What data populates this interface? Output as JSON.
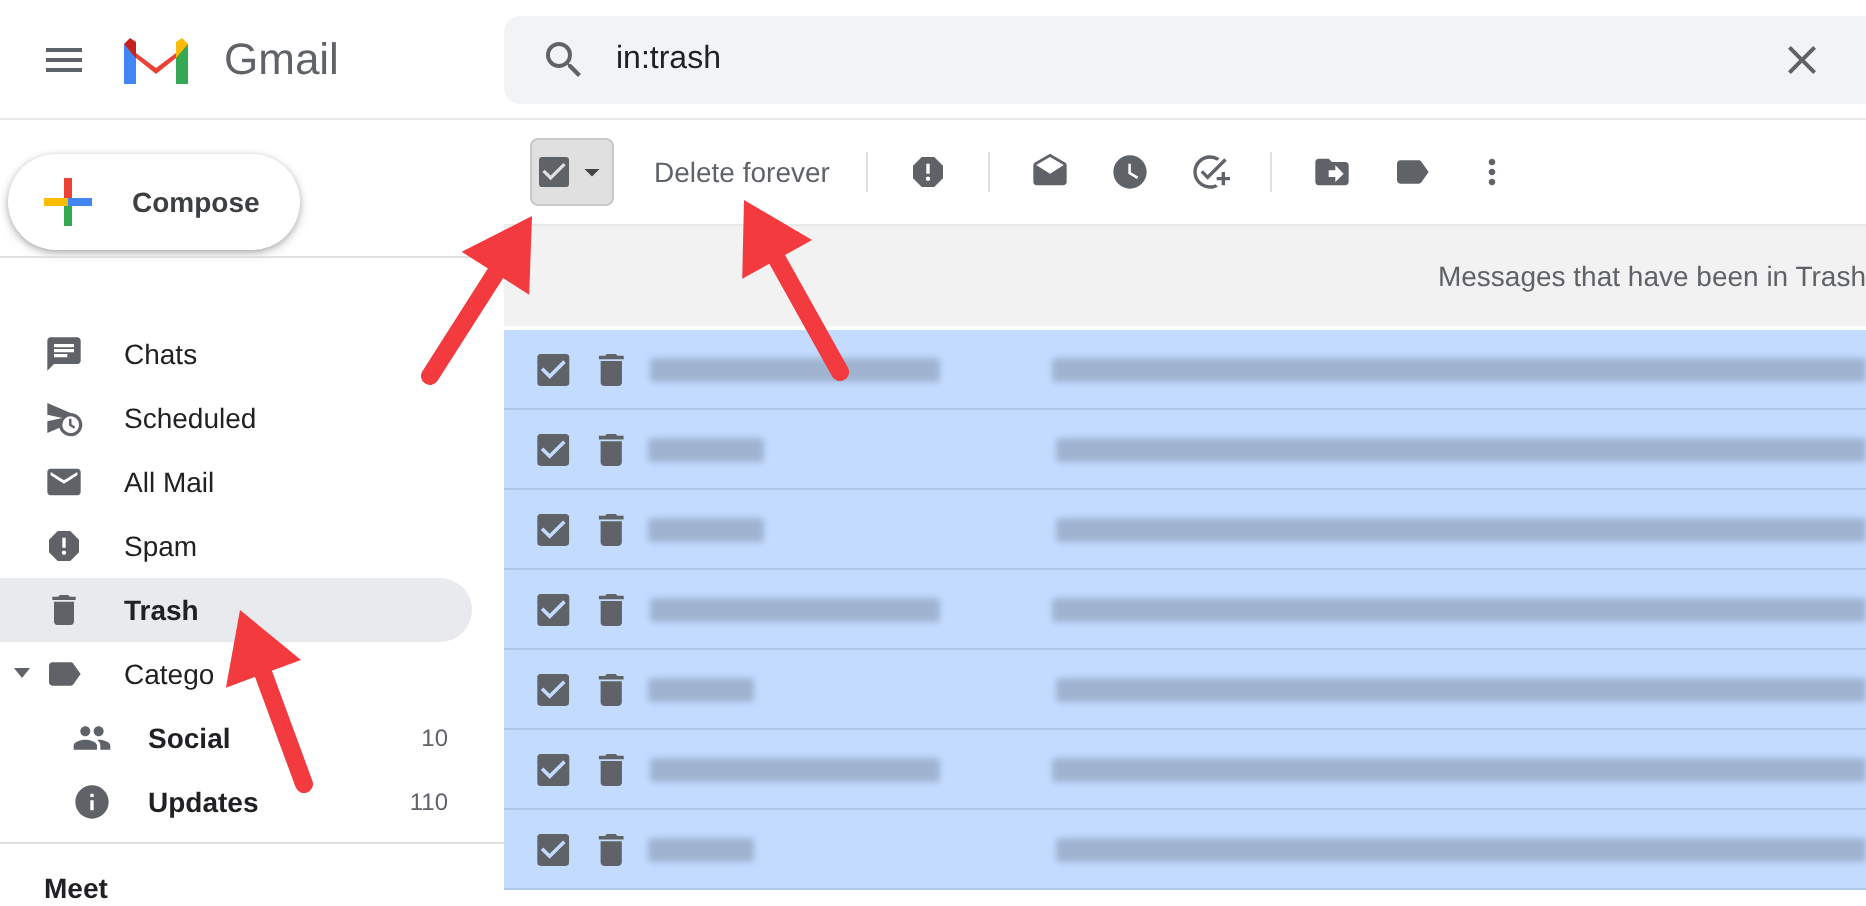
{
  "header": {
    "app_name": "Gmail",
    "search": {
      "value": "in:trash"
    }
  },
  "compose": {
    "label": "Compose"
  },
  "sidebar": {
    "items": [
      {
        "label": "Chats",
        "selected": false
      },
      {
        "label": "Scheduled",
        "selected": false
      },
      {
        "label": "All Mail",
        "selected": false
      },
      {
        "label": "Spam",
        "selected": false
      },
      {
        "label": "Trash",
        "selected": true
      },
      {
        "label": "Catego",
        "selected": false,
        "expanded": true,
        "children": [
          {
            "label": "Social",
            "selected": false,
            "unread": true,
            "count": "10"
          },
          {
            "label": "Updates",
            "selected": false,
            "unread": true,
            "count": "110"
          }
        ]
      }
    ],
    "section": "Meet"
  },
  "toolbar": {
    "select_all": {
      "checked": true
    },
    "delete_button": "Delete forever"
  },
  "notice": "Messages that have been in Trash",
  "rows": [
    {
      "checked": true
    },
    {
      "checked": true
    },
    {
      "checked": true
    },
    {
      "checked": true
    },
    {
      "checked": true
    },
    {
      "checked": true
    },
    {
      "checked": true
    }
  ]
}
